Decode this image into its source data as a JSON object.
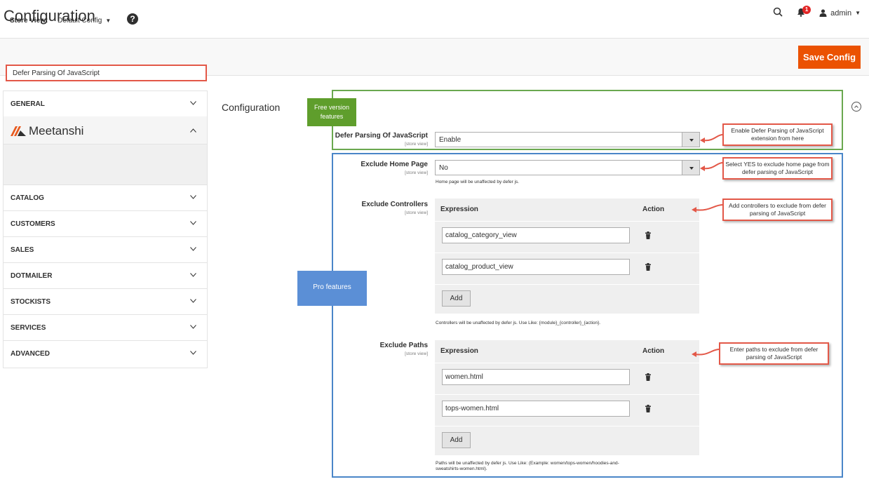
{
  "header": {
    "title": "Configuration",
    "notification_count": "1",
    "user_name": "admin"
  },
  "store_bar": {
    "label": "Store View:",
    "value": "Default Config",
    "save_label": "Save Config"
  },
  "sidebar": {
    "items": [
      {
        "label": "GENERAL"
      },
      {
        "label": "CATALOG"
      },
      {
        "label": "CUSTOMERS"
      },
      {
        "label": "SALES"
      },
      {
        "label": "DOTMAILER"
      },
      {
        "label": "STOCKISTS"
      },
      {
        "label": "SERVICES"
      },
      {
        "label": "ADVANCED"
      }
    ],
    "meetanshi": {
      "brand": "Meetanshi",
      "sub_item": "Defer Parsing Of JavaScript"
    }
  },
  "main": {
    "section_title": "Configuration",
    "free_tag": "Free version features",
    "pro_tag": "Pro features",
    "scope": "[store view]",
    "defer": {
      "label": "Defer Parsing Of JavaScript",
      "value": "Enable"
    },
    "exclude_home": {
      "label": "Exclude Home Page",
      "value": "No",
      "note": "Home page will be unaffected by defer js."
    },
    "exclude_controllers": {
      "label": "Exclude Controllers",
      "col_expression": "Expression",
      "col_action": "Action",
      "rows": [
        "catalog_category_view",
        "catalog_product_view"
      ],
      "add_label": "Add",
      "note": "Controllers will be unaffected by defer js. Use Like: {module}_{controller}_{action}."
    },
    "exclude_paths": {
      "label": "Exclude Paths",
      "col_expression": "Expression",
      "col_action": "Action",
      "rows": [
        "women.html",
        "tops-women.html"
      ],
      "add_label": "Add",
      "note_line1": "Paths will be unaffected by defer js. Use Like: (Example: women/tops-women/hoodies-and-",
      "note_line2": "sweatshirts-women.html)."
    }
  },
  "callouts": {
    "enable": "Enable Defer Parsing of JavaScript extension from here",
    "home": "Select YES to exclude home page from defer parsing of JavaScript",
    "controllers": "Add controllers to exclude from defer parsing of JavaScript",
    "paths": "Enter paths to exclude from defer parsing of JavaScript"
  },
  "colors": {
    "accent": "#eb5202",
    "free": "#5f9e2c",
    "pro": "#5b8fd6",
    "callout_border": "#e35848"
  }
}
